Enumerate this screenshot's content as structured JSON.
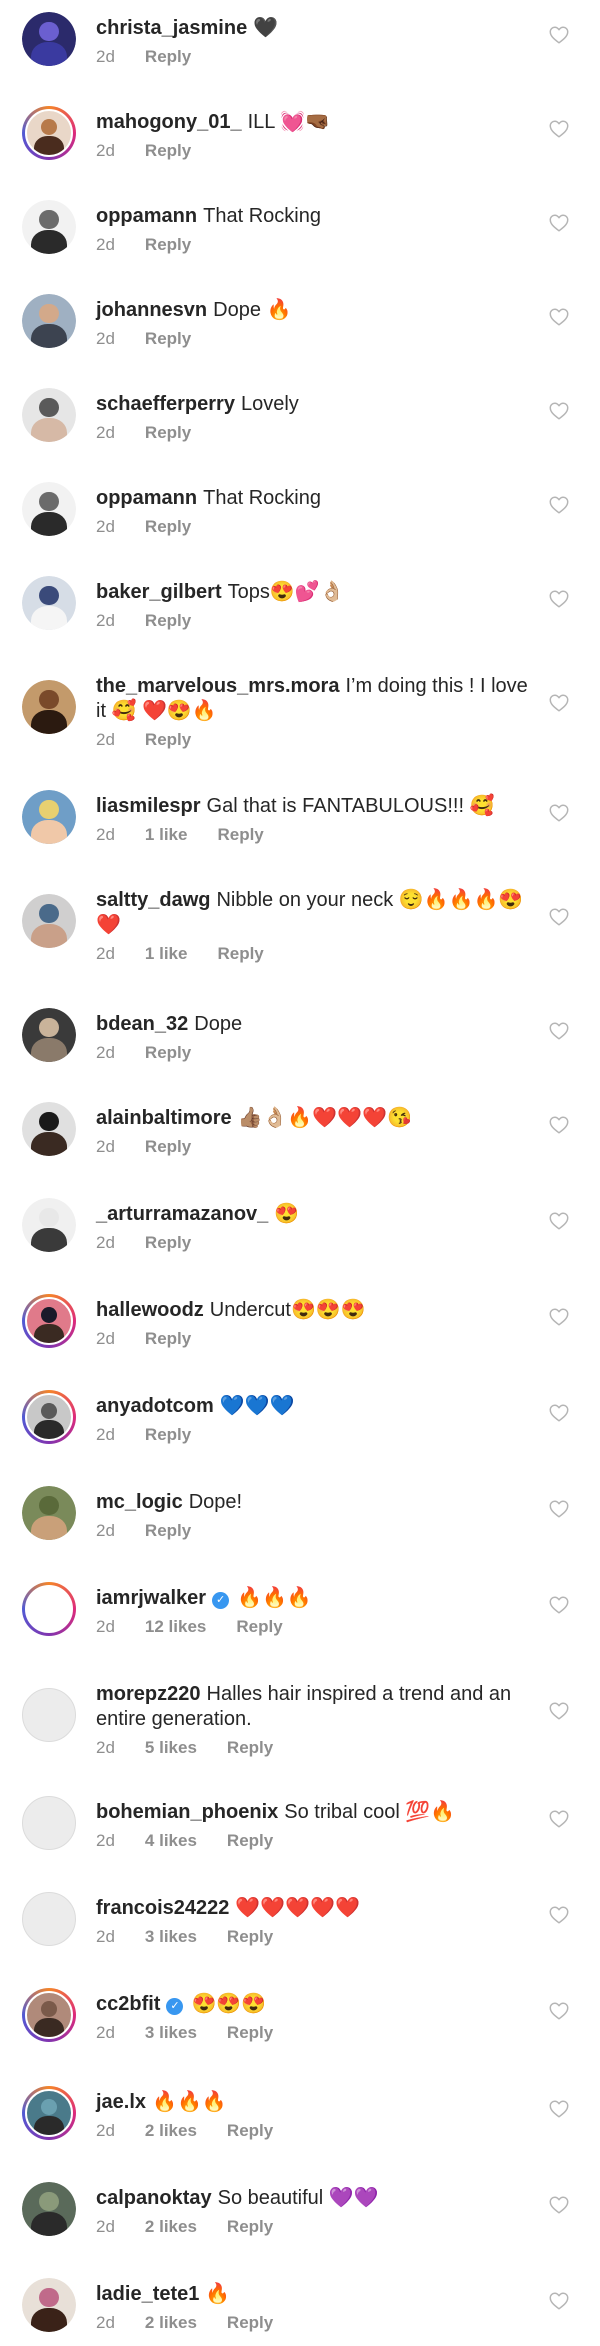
{
  "comments": [
    {
      "username": "christa_jasmine",
      "text": "🖤",
      "time": "2d",
      "likes": "",
      "reply": "Reply",
      "verified": false,
      "ring": false,
      "av": [
        "#2b2a6b",
        "#3a3aa0",
        "#6b5fd0"
      ]
    },
    {
      "username": "mahogony_01_",
      "text": "ILL 💓🤜🏾",
      "time": "2d",
      "likes": "",
      "reply": "Reply",
      "verified": false,
      "ring": true,
      "av": [
        "#e9d7c8",
        "#4a2c1e",
        "#b77a4a"
      ]
    },
    {
      "username": "oppamann",
      "text": "That Rocking",
      "time": "2d",
      "likes": "",
      "reply": "Reply",
      "verified": false,
      "ring": false,
      "av": [
        "#f2f2f2",
        "#2a2a2a",
        "#6b6b6b"
      ]
    },
    {
      "username": "johannesvn",
      "text": "Dope 🔥",
      "time": "2d",
      "likes": "",
      "reply": "Reply",
      "verified": false,
      "ring": false,
      "av": [
        "#9fb0c2",
        "#3c4350",
        "#d3a98a"
      ]
    },
    {
      "username": "schaefferperry",
      "text": "Lovely",
      "time": "2d",
      "likes": "",
      "reply": "Reply",
      "verified": false,
      "ring": false,
      "av": [
        "#e6e6e6",
        "#d6b9a6",
        "#5a5a5a"
      ]
    },
    {
      "username": "oppamann",
      "text": "That Rocking",
      "time": "2d",
      "likes": "",
      "reply": "Reply",
      "verified": false,
      "ring": false,
      "av": [
        "#f2f2f2",
        "#2a2a2a",
        "#6b6b6b"
      ]
    },
    {
      "username": "baker_gilbert",
      "text": "Tops😍💕👌🏼",
      "time": "2d",
      "likes": "",
      "reply": "Reply",
      "verified": false,
      "ring": false,
      "av": [
        "#d6dde6",
        "#f5f5f5",
        "#3a4a7a"
      ]
    },
    {
      "username": "the_marvelous_mrs.mora",
      "text": "I’m doing this ! I love it 🥰 ❤️😍🔥",
      "time": "2d",
      "likes": "",
      "reply": "Reply",
      "verified": false,
      "ring": false,
      "av": [
        "#c39a6b",
        "#2b1a10",
        "#7a4a2a"
      ]
    },
    {
      "username": "liasmilespr",
      "text": "Gal that is FANTABULOUS!!! 🥰",
      "time": "2d",
      "likes": "1 like",
      "reply": "Reply",
      "verified": false,
      "ring": false,
      "av": [
        "#6f9ec7",
        "#f0c8a8",
        "#e8d070"
      ]
    },
    {
      "username": "saltty_dawg",
      "text": "Nibble on your neck 😌🔥🔥🔥😍❤️",
      "time": "2d",
      "likes": "1 like",
      "reply": "Reply",
      "verified": false,
      "ring": false,
      "av": [
        "#d0cfcf",
        "#c9a089",
        "#4a6a8a"
      ]
    },
    {
      "username": "bdean_32",
      "text": "Dope",
      "time": "2d",
      "likes": "",
      "reply": "Reply",
      "verified": false,
      "ring": false,
      "av": [
        "#3a3a3a",
        "#8a7a6a",
        "#c9b39a"
      ]
    },
    {
      "username": "alainbaltimore",
      "text": "👍🏽👌🏼🔥❤️❤️❤️😘",
      "time": "2d",
      "likes": "",
      "reply": "Reply",
      "verified": false,
      "ring": false,
      "av": [
        "#e0e0e0",
        "#3a2a22",
        "#1a1a1a"
      ]
    },
    {
      "username": "_arturramazanov_",
      "text": "😍",
      "time": "2d",
      "likes": "",
      "reply": "Reply",
      "verified": false,
      "ring": false,
      "av": [
        "#f0f0f0",
        "#3a3a3a",
        "#e8e8e8"
      ]
    },
    {
      "username": "hallewoodz",
      "text": "Undercut😍😍😍",
      "time": "2d",
      "likes": "",
      "reply": "Reply",
      "verified": false,
      "ring": true,
      "av": [
        "#e07a8a",
        "#3a2a22",
        "#1a1a2a"
      ]
    },
    {
      "username": "anyadotcom",
      "text": "💙💙💙",
      "time": "2d",
      "likes": "",
      "reply": "Reply",
      "verified": false,
      "ring": true,
      "av": [
        "#c8c8c8",
        "#2a2a2a",
        "#5a5a5a"
      ]
    },
    {
      "username": "mc_logic",
      "text": "Dope!",
      "time": "2d",
      "likes": "",
      "reply": "Reply",
      "verified": false,
      "ring": false,
      "av": [
        "#7a8a5a",
        "#c9a079",
        "#5a6a3a"
      ]
    },
    {
      "username": "iamrjwalker",
      "text": "🔥🔥🔥",
      "time": "2d",
      "likes": "12 likes",
      "reply": "Reply",
      "verified": true,
      "ring": true,
      "av": [
        "#ffffff",
        "#ffffff",
        "#ffffff"
      ]
    },
    {
      "username": "morepz220",
      "text": "Halles hair inspired a trend and an entire generation.",
      "time": "2d",
      "likes": "5 likes",
      "reply": "Reply",
      "verified": false,
      "ring": false,
      "plain": true,
      "av": [
        "#ececec",
        "#ececec",
        "#ececec"
      ]
    },
    {
      "username": "bohemian_phoenix",
      "text": "So tribal cool 💯🔥",
      "time": "2d",
      "likes": "4 likes",
      "reply": "Reply",
      "verified": false,
      "ring": false,
      "plain": true,
      "av": [
        "#ececec",
        "#ececec",
        "#ececec"
      ]
    },
    {
      "username": "francois24222",
      "text": "❤️❤️❤️❤️❤️",
      "time": "2d",
      "likes": "3 likes",
      "reply": "Reply",
      "verified": false,
      "ring": false,
      "plain": true,
      "av": [
        "#ececec",
        "#ececec",
        "#ececec"
      ]
    },
    {
      "username": "cc2bfit",
      "text": "😍😍😍",
      "time": "2d",
      "likes": "3 likes",
      "reply": "Reply",
      "verified": true,
      "ring": true,
      "av": [
        "#b08a7a",
        "#3a2a22",
        "#7a5a4a"
      ]
    },
    {
      "username": "jae.lx",
      "text": "🔥🔥🔥",
      "time": "2d",
      "likes": "2 likes",
      "reply": "Reply",
      "verified": false,
      "ring": true,
      "av": [
        "#4a7a8a",
        "#2a2a2a",
        "#6aa0b0"
      ]
    },
    {
      "username": "calpanoktay",
      "text": "So beautiful 💜💜",
      "time": "2d",
      "likes": "2 likes",
      "reply": "Reply",
      "verified": false,
      "ring": false,
      "av": [
        "#5a6a5a",
        "#2a2a2a",
        "#8a9a7a"
      ]
    },
    {
      "username": "ladie_tete1",
      "text": "🔥",
      "time": "2d",
      "likes": "2 likes",
      "reply": "Reply",
      "verified": false,
      "ring": false,
      "av": [
        "#e8e0d8",
        "#3a2218",
        "#c06a8a"
      ]
    }
  ],
  "colors": {
    "muted": "#8e8e8e",
    "text": "#262626",
    "verified": "#3897f0"
  },
  "icons": {
    "like": "heart-outline-icon",
    "verified": "verified-badge-icon"
  }
}
